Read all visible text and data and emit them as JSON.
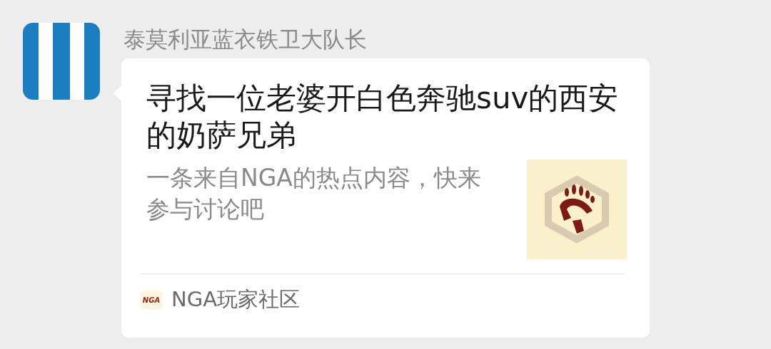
{
  "sender": {
    "name": "泰莫利亚蓝衣铁卫大队长"
  },
  "card": {
    "title": "寻找一位老婆开白色奔驰suv的西安的奶萨兄弟",
    "description": "一条来自NGA的热点内容，快来参与讨论吧",
    "source": {
      "logo_text": "NGA",
      "name": "NGA玩家社区"
    }
  }
}
